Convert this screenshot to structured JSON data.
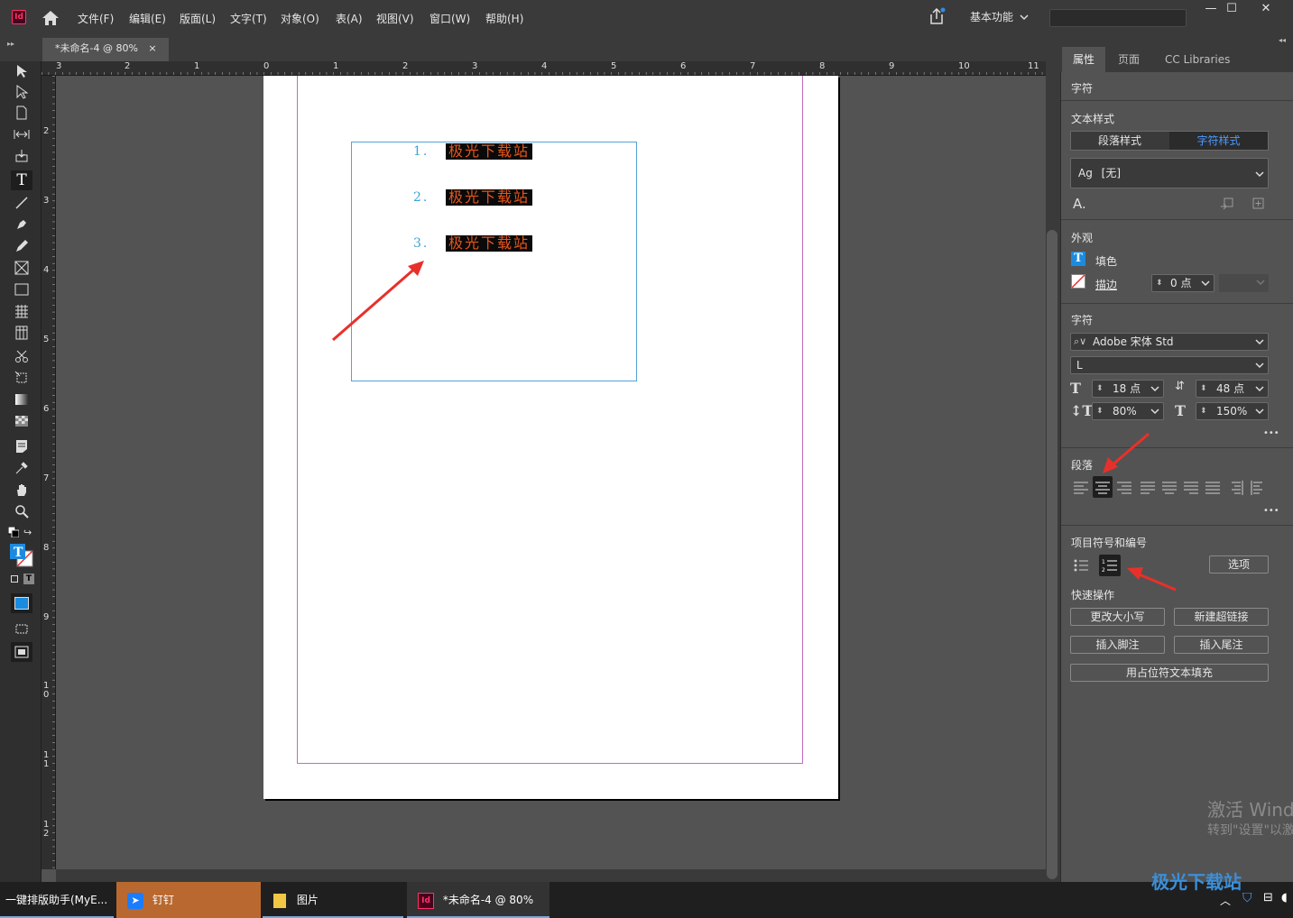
{
  "menubar": {
    "app_icon": "Id",
    "items": [
      "文件(F)",
      "编辑(E)",
      "版面(L)",
      "文字(T)",
      "对象(O)",
      "表(A)",
      "视图(V)",
      "窗口(W)",
      "帮助(H)"
    ],
    "workspace": "基本功能",
    "window_buttons": [
      "—",
      "☐",
      "✕"
    ]
  },
  "document_tab": {
    "label": "*未命名-4 @ 80%",
    "close": "×"
  },
  "ruler": {
    "top_labels": [
      "3",
      "2",
      "1",
      "0",
      "1",
      "2",
      "3",
      "4",
      "5",
      "6",
      "7",
      "8",
      "9",
      "10",
      "11"
    ],
    "left_labels": [
      "2",
      "3",
      "4",
      "5",
      "6",
      "7",
      "8",
      "9",
      "1 0",
      "1 1",
      "1 2"
    ]
  },
  "document": {
    "list_items": [
      {
        "number": "1.",
        "text": "极光下载站"
      },
      {
        "number": "2.",
        "text": "极光下载站"
      },
      {
        "number": "3.",
        "text": "极光下载站"
      }
    ]
  },
  "panel": {
    "tabs": [
      "属性",
      "页面",
      "CC Libraries"
    ],
    "context": "字符",
    "text_style": {
      "title": "文本样式",
      "seg_paragraph": "段落样式",
      "seg_character": "字符样式",
      "style_prefix": "Ag",
      "style_value": "[无]"
    },
    "appearance": {
      "title": "外观",
      "fill_label": "填色",
      "stroke_label": "描边",
      "stroke_weight": "0 点"
    },
    "character": {
      "title": "字符",
      "font": "Adobe 宋体 Std",
      "style": "L",
      "size": "18 点",
      "leading": "48 点",
      "vscale": "80%",
      "hscale": "150%",
      "more": "•••"
    },
    "paragraph": {
      "title": "段落",
      "more": "•••"
    },
    "bullets": {
      "title": "项目符号和编号",
      "options": "选项"
    },
    "quick": {
      "title": "快速操作",
      "change_case": "更改大小写",
      "new_hyperlink": "新建超链接",
      "insert_footnote": "插入脚注",
      "insert_endnote": "插入尾注",
      "fill_placeholder": "用占位符文本填充"
    }
  },
  "os": {
    "activate_line1": "激活 Wind",
    "activate_line2": "转到\"设置\"以激",
    "watermark": "极光下载站"
  },
  "taskbar": {
    "items": [
      "一键排版助手(MyE...",
      "钉钉",
      "图片",
      "*未命名-4 @ 80%"
    ]
  },
  "colors": {
    "accent": "#3aa3d8",
    "highlight_text": "#e8561a",
    "arrow": "#e8302a",
    "frame": "#52a3d9",
    "dingding_task": "#b9692f"
  }
}
